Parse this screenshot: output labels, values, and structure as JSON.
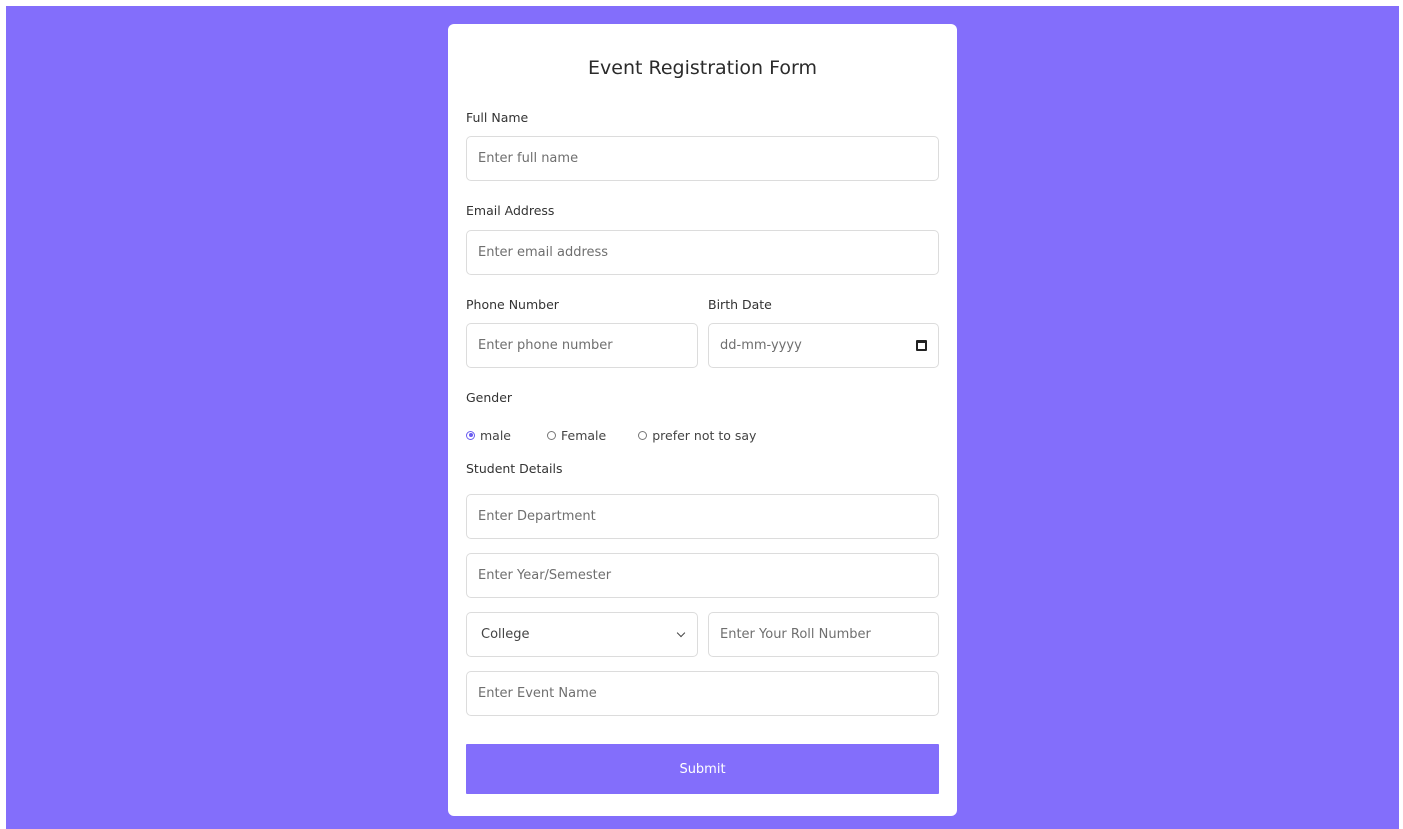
{
  "colors": {
    "background": "#836efb",
    "card": "#ffffff",
    "accent": "#836efb",
    "radio_checked": "#6a5cf0"
  },
  "form": {
    "title": "Event Registration Form",
    "full_name": {
      "label": "Full Name",
      "placeholder": "Enter full name"
    },
    "email": {
      "label": "Email Address",
      "placeholder": "Enter email address"
    },
    "phone": {
      "label": "Phone Number",
      "placeholder": "Enter phone number"
    },
    "birth_date": {
      "label": "Birth Date",
      "placeholder": "dd-mm-yyyy",
      "icon": "calendar-icon"
    },
    "gender": {
      "label": "Gender",
      "options": [
        "male",
        "Female",
        "prefer not to say"
      ],
      "selected": "male"
    },
    "student_details": {
      "label": "Student Details",
      "department_placeholder": "Enter Department",
      "year_placeholder": "Enter Year/Semester",
      "college_selected": "College",
      "roll_placeholder": "Enter Your Roll Number",
      "event_placeholder": "Enter Event Name"
    },
    "submit_label": "Submit"
  }
}
